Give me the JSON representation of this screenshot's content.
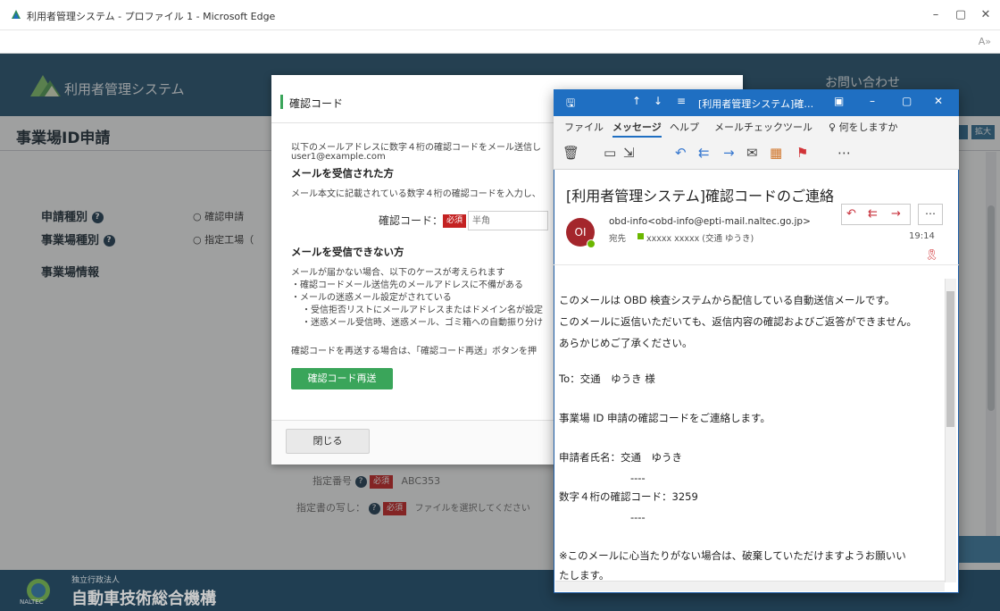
{
  "browser": {
    "title": "利用者管理システム - プロファイル 1 - Microsoft Edge",
    "read_aloud_icon": "read-aloud-icon"
  },
  "app": {
    "logo_text": "利用者管理システム",
    "contact_link": "お問い合わせ",
    "page_title": "事業場ID申請",
    "text_size_large": "拡大",
    "form": {
      "app_type_label": "申請種別",
      "app_type_value": "○ 確認申請",
      "site_type_label": "事業場種別",
      "site_type_value": "○ 指定工場（",
      "site_info_label": "事業場情報",
      "designation_label": "指定番号",
      "designation_value": "ABC353",
      "designation_doc_label": "指定書の写し：",
      "designation_doc_value": "ファイルを選択してください",
      "required_badge": "必須"
    },
    "footer": {
      "org_small": "独立行政法人",
      "org_big": "自動車技術総合機構",
      "org_logo_text": "NALTEC"
    }
  },
  "modal": {
    "title": "確認コード",
    "intro_line1": "以下のメールアドレスに数字４桁の確認コードをメール送信し",
    "email": "user1@example.com",
    "received_heading": "メールを受信された方",
    "received_text": "メール本文に記載されている数字４桁の確認コードを入力し、",
    "code_label": "確認コード：",
    "required_badge": "必須",
    "code_placeholder": "半角",
    "not_received_heading": "メールを受信できない方",
    "not_received_lines": [
      "メールが届かない場合、以下のケースが考えられます",
      "・確認コードメール送信先のメールアドレスに不備がある",
      "・メールの迷惑メール設定がされている",
      "・受信拒否リストにメールアドレスまたはドメイン名が設定",
      "・迷惑メール受信時、迷惑メール、ゴミ箱への自動振り分け"
    ],
    "resend_hint": "確認コードを再送する場合は、「確認コード再送」ボタンを押",
    "resend_button": "確認コード再送",
    "close_button": "閉じる"
  },
  "outlook": {
    "titlebar_text": "[利用者管理システム]確…",
    "tabs": [
      "ファイル",
      "メッセージ",
      "ヘルプ",
      "メールチェックツール"
    ],
    "tell_me": "何をしますか",
    "subject": "[利用者管理システム]確認コードのご連絡",
    "avatar_initials": "OI",
    "from": "obd-info<obd-info@epti-mail.naltec.go.jp>",
    "to_prefix": "宛先",
    "to_value": "xxxxx xxxxx (交通 ゆうき)",
    "time": "19:14",
    "body_lines": [
      "このメールは OBD 検査システムから配信している自動送信メールです。",
      "このメールに返信いただいても、返信内容の確認およびご返答ができません。",
      "あらかじめご了承ください。",
      "To：交通　ゆうき 様",
      "事業場 ID 申請の確認コードをご連絡します。",
      "申請者氏名：交通　ゆうき",
      "----",
      "数字４桁の確認コード：3259",
      "----",
      "※このメールに心当たりがない場合は、破棄していただけますようお願いい",
      "たします。"
    ]
  }
}
